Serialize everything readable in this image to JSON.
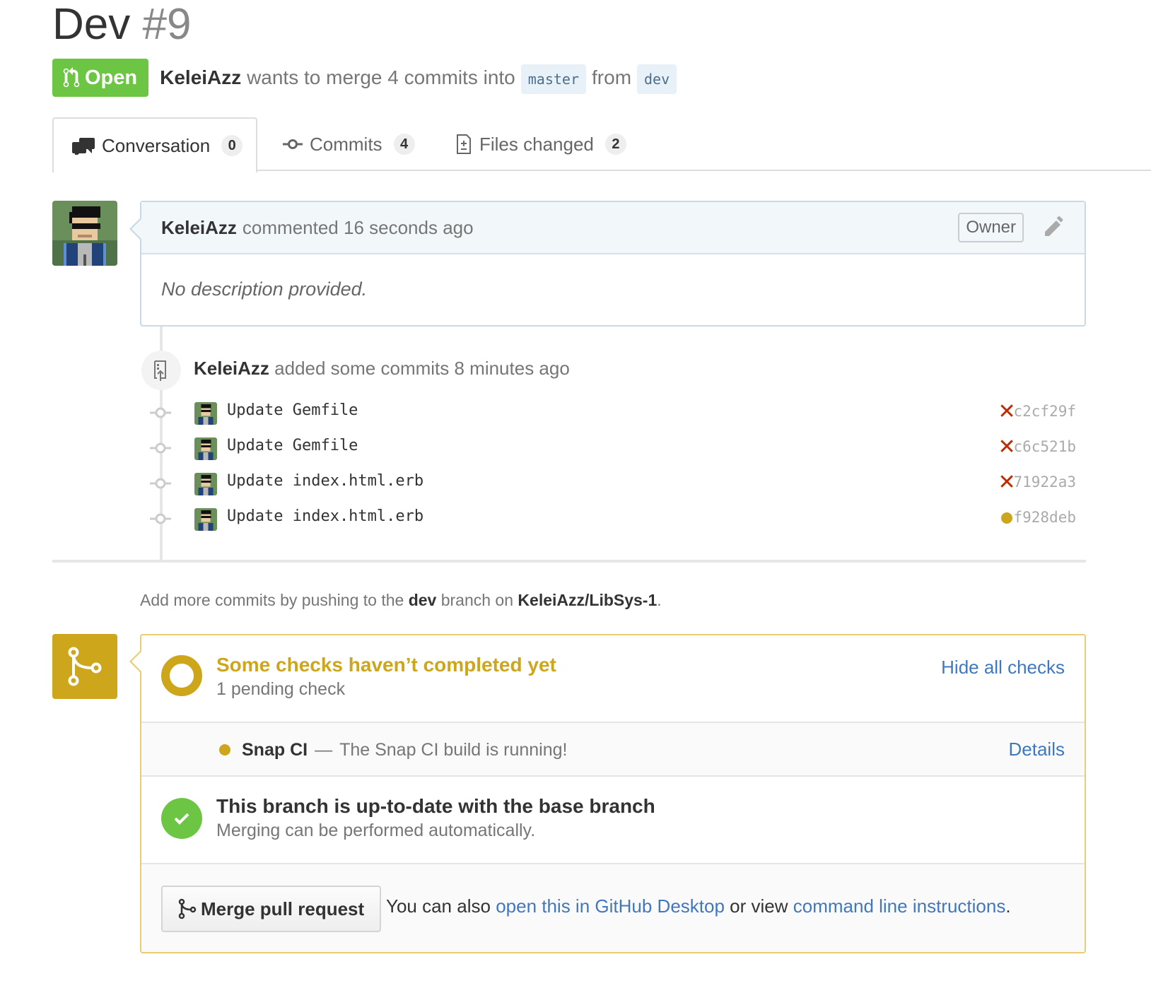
{
  "pr": {
    "title": "Dev",
    "number": "#9",
    "state": "Open",
    "author": "KeleiAzz",
    "merge_text": "wants to merge 4 commits into",
    "base_branch": "master",
    "from_text": "from",
    "head_branch": "dev"
  },
  "tabs": [
    {
      "label": "Conversation",
      "count": "0",
      "icon": "comment-discussion-icon",
      "selected": true
    },
    {
      "label": "Commits",
      "count": "4",
      "icon": "git-commit-icon",
      "selected": false
    },
    {
      "label": "Files changed",
      "count": "2",
      "icon": "diff-icon",
      "selected": false
    }
  ],
  "comment": {
    "author": "KeleiAzz",
    "action": "commented 16 seconds ago",
    "role": "Owner",
    "body": "No description provided."
  },
  "push_event": {
    "author": "KeleiAzz",
    "text": "added some commits 8 minutes ago"
  },
  "commits": [
    {
      "message": "Update Gemfile",
      "sha": "c2cf29f",
      "status": "failure"
    },
    {
      "message": "Update Gemfile",
      "sha": "c6c521b",
      "status": "failure"
    },
    {
      "message": "Update index.html.erb",
      "sha": "71922a3",
      "status": "failure"
    },
    {
      "message": "Update index.html.erb",
      "sha": "f928deb",
      "status": "pending"
    }
  ],
  "hint": {
    "prefix": "Add more commits by pushing to the",
    "branch": "dev",
    "middle": "branch on",
    "repo": "KeleiAzz/LibSys-1",
    "suffix": "."
  },
  "checks": {
    "title": "Some checks haven’t completed yet",
    "subtitle": "1 pending check",
    "hide_link": "Hide all checks",
    "items": [
      {
        "name": "Snap CI",
        "separator": "—",
        "description": "The Snap CI build is running!",
        "details_link": "Details"
      }
    ]
  },
  "branch_status": {
    "title": "This branch is up-to-date with the base branch",
    "subtitle": "Merging can be performed automatically."
  },
  "merge": {
    "button_label": "Merge pull request",
    "also_prefix": "You can also",
    "desktop_link": "open this in GitHub Desktop",
    "or_text": "or view",
    "cli_link": "command line instructions",
    "suffix": "."
  },
  "colors": {
    "open_green": "#6cc644",
    "pending_yellow": "#cea61b",
    "failure_red": "#bd2c00",
    "link_blue": "#4078c0"
  }
}
